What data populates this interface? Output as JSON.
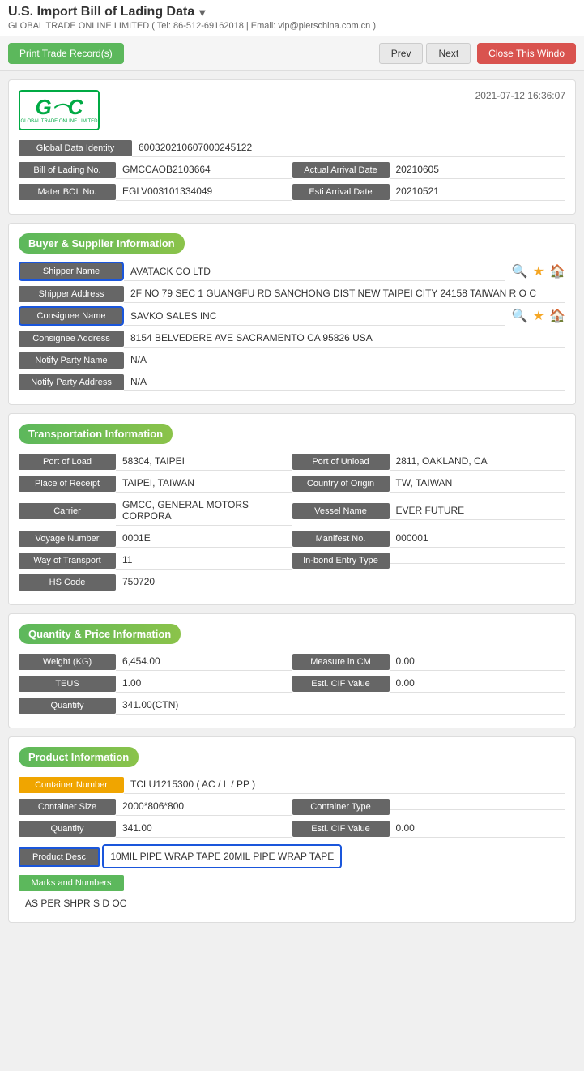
{
  "page": {
    "title": "U.S. Import Bill of Lading Data",
    "title_arrow": "▾",
    "company_info": "GLOBAL TRADE ONLINE LIMITED ( Tel: 86-512-69162018 | Email: vip@pierschina.com.cn )"
  },
  "toolbar": {
    "print_btn": "Print Trade Record(s)",
    "prev_btn": "Prev",
    "next_btn": "Next",
    "close_btn": "Close This Windo"
  },
  "logo": {
    "text": "GTC",
    "subtitle": "GLOBAL TRADE ONLINE LIMITED",
    "datetime": "2021-07-12 16:36:07"
  },
  "identity": {
    "label": "Global Data Identity",
    "value": "600320210607000245122"
  },
  "bol": {
    "label": "Bill of Lading No.",
    "value": "GMCCAOB2103664",
    "arrival_label": "Actual Arrival Date",
    "arrival_value": "20210605"
  },
  "mbol": {
    "label": "Mater BOL No.",
    "value": "EGLV003101334049",
    "esti_label": "Esti Arrival Date",
    "esti_value": "20210521"
  },
  "buyer_supplier": {
    "section_title": "Buyer & Supplier Information",
    "shipper_name_label": "Shipper Name",
    "shipper_name_value": "AVATACK CO LTD",
    "shipper_address_label": "Shipper Address",
    "shipper_address_value": "2F NO 79 SEC 1 GUANGFU RD SANCHONG DIST NEW TAIPEI CITY 24158 TAIWAN R O C",
    "consignee_name_label": "Consignee Name",
    "consignee_name_value": "SAVKO SALES INC",
    "consignee_address_label": "Consignee Address",
    "consignee_address_value": "8154 BELVEDERE AVE SACRAMENTO CA 95826 USA",
    "notify_party_name_label": "Notify Party Name",
    "notify_party_name_value": "N/A",
    "notify_party_address_label": "Notify Party Address",
    "notify_party_address_value": "N/A"
  },
  "transportation": {
    "section_title": "Transportation Information",
    "port_of_load_label": "Port of Load",
    "port_of_load_value": "58304, TAIPEI",
    "port_of_unload_label": "Port of Unload",
    "port_of_unload_value": "2811, OAKLAND, CA",
    "place_of_receipt_label": "Place of Receipt",
    "place_of_receipt_value": "TAIPEI, TAIWAN",
    "country_of_origin_label": "Country of Origin",
    "country_of_origin_value": "TW, TAIWAN",
    "carrier_label": "Carrier",
    "carrier_value": "GMCC, GENERAL MOTORS CORPORA",
    "vessel_name_label": "Vessel Name",
    "vessel_name_value": "EVER FUTURE",
    "voyage_number_label": "Voyage Number",
    "voyage_number_value": "0001E",
    "manifest_no_label": "Manifest No.",
    "manifest_no_value": "000001",
    "way_of_transport_label": "Way of Transport",
    "way_of_transport_value": "11",
    "in_bond_label": "In-bond Entry Type",
    "in_bond_value": "",
    "hs_code_label": "HS Code",
    "hs_code_value": "750720"
  },
  "quantity_price": {
    "section_title": "Quantity & Price Information",
    "weight_label": "Weight (KG)",
    "weight_value": "6,454.00",
    "measure_label": "Measure in CM",
    "measure_value": "0.00",
    "teus_label": "TEUS",
    "teus_value": "1.00",
    "esti_cif_label": "Esti. CIF Value",
    "esti_cif_value": "0.00",
    "quantity_label": "Quantity",
    "quantity_value": "341.00(CTN)"
  },
  "product": {
    "section_title": "Product Information",
    "container_number_label": "Container Number",
    "container_number_value": "TCLU1215300 ( AC / L / PP )",
    "container_size_label": "Container Size",
    "container_size_value": "2000*806*800",
    "container_type_label": "Container Type",
    "container_type_value": "",
    "quantity_label": "Quantity",
    "quantity_value": "341.00",
    "esti_cif_label": "Esti. CIF Value",
    "esti_cif_value": "0.00",
    "product_desc_label": "Product Desc",
    "product_desc_value": "10MIL PIPE WRAP TAPE 20MIL PIPE WRAP TAPE",
    "marks_numbers_label": "Marks and Numbers",
    "marks_numbers_value": "AS PER SHPR S D OC"
  },
  "icons": {
    "search": "🔍",
    "star": "★",
    "home": "🏠"
  }
}
